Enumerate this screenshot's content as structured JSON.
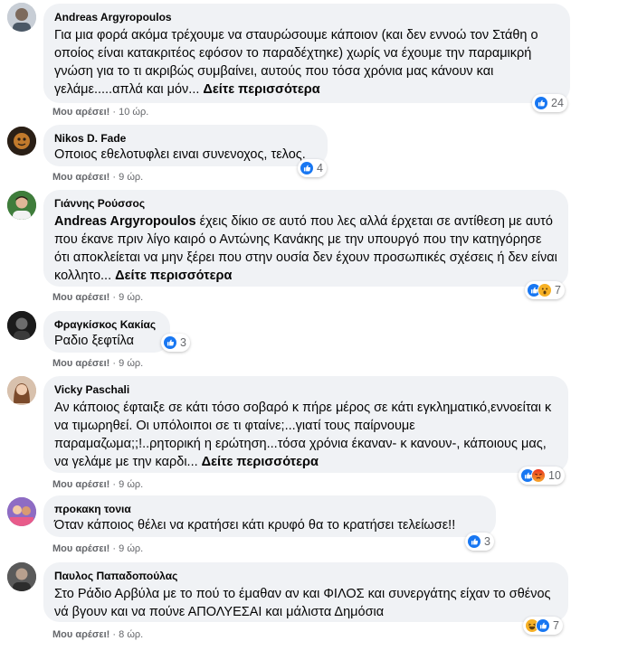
{
  "reactions_colors": {
    "like": "#1877f2",
    "wow": "#f7b125",
    "angry": "#e9710f",
    "haha": "#f7b125"
  },
  "comments": [
    {
      "author": "Andreas Argyropoulos",
      "text": "Για μια φορά ακόμα τρέχουμε να σταυρώσουμε κάποιον (και δεν εννοώ τον Στάθη ο οποίος είναι κατακριτέος εφόσον το παραδέχτηκε) χωρίς να έχουμε την παραμικρή γνώση για το τι ακριβώς συμβαίνει, αυτούς που τόσα χρόνια μας κάνουν και γελάμε.....απλά και μόν...",
      "see_more": "Δείτε περισσότερα",
      "like_label": "Μου αρέσει!",
      "time": "10 ώρ.",
      "reaction_count": "24",
      "reaction_icons": [
        "like-icon"
      ]
    },
    {
      "author": "Nikos D. Fade",
      "text": "Οποιος εθελοτυφλει ειναι συνενοχος, τελος.",
      "like_label": "Μου αρέσει!",
      "time": "9 ώρ.",
      "reaction_count": "4",
      "reaction_icons": [
        "like-icon"
      ]
    },
    {
      "author": "Γιάννης Ρούσσος",
      "mention": "Andreas Argyropoulos",
      "text": " έχεις δίκιο σε αυτό που λες αλλά έρχεται σε αντίθεση με αυτό που έκανε πριν λίγο καιρό ο Αντώνης Κανάκης με την υπουργό που την κατηγόρησε ότι αποκλείεται να μην ξέρει που στην ουσία δεν έχουν προσωπικές σχέσεις ή δεν είναι κολλητο...",
      "see_more": "Δείτε περισσότερα",
      "like_label": "Μου αρέσει!",
      "time": "9 ώρ.",
      "reaction_count": "7",
      "reaction_icons": [
        "like-icon",
        "wow-icon"
      ]
    },
    {
      "author": "Φραγκίσκος Κακίας",
      "text": "Ραδιο ξεφτίλα",
      "like_label": "Μου αρέσει!",
      "time": "9 ώρ.",
      "reaction_count": "3",
      "reaction_icons": [
        "like-icon"
      ]
    },
    {
      "author": "Vicky Paschali",
      "text": "Αν κάποιος έφταιξε σε κάτι τόσο σοβαρό κ πήρε μέρος σε κάτι εγκληματικό,εννοείται κ να τιμωρηθεί. Οι υπόλοιποι σε τι φταίνε;...γιατί τους παίρνουμε παραμαζωμα;;!..ρητορική η ερώτηση...τόσα χρόνια έκαναν- κ κανουν-, κάποιους μας, να γελάμε με την καρδι...",
      "see_more": "Δείτε περισσότερα",
      "like_label": "Μου αρέσει!",
      "time": "9 ώρ.",
      "reaction_count": "10",
      "reaction_icons": [
        "like-icon",
        "angry-icon"
      ]
    },
    {
      "author": "προκακη τονια",
      "text": "Όταν κάποιος θέλει να κρατήσει κάτι κρυφό θα το κρατήσει τελείωσε!!",
      "like_label": "Μου αρέσει!",
      "time": "9 ώρ.",
      "reaction_count": "3",
      "reaction_icons": [
        "like-icon"
      ]
    },
    {
      "author": "Παυλος Παπαδοπούλας",
      "text": "Στο Ράδιο Αρβύλα με το πού το έμαθαν αν και ΦΙΛΟΣ και συνεργάτης είχαν το σθένος νά βγουν και να πούνε ΑΠΟΛΥΕΣΑΙ και μάλιστα Δημόσια",
      "like_label": "Μου αρέσει!",
      "time": "8 ώρ.",
      "reaction_count": "7",
      "reaction_icons": [
        "haha-icon",
        "like-icon"
      ]
    }
  ]
}
